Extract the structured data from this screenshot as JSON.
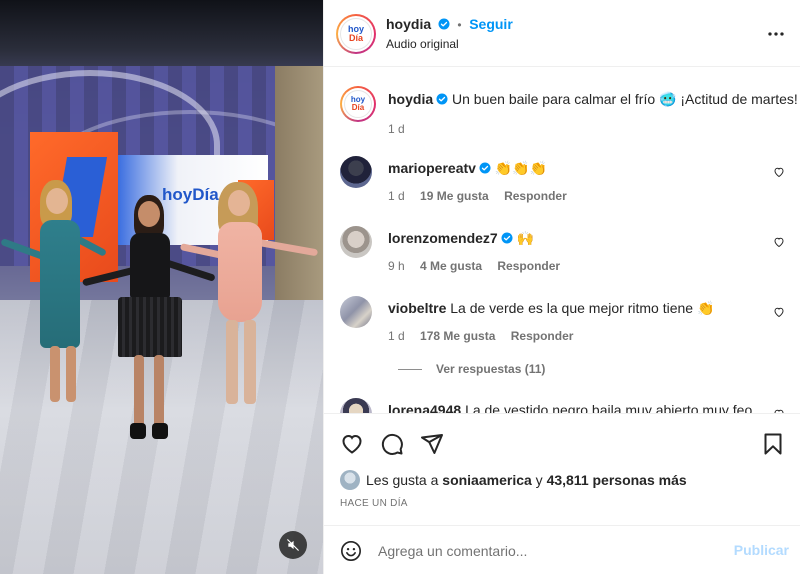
{
  "video": {
    "set_logo": "hoyDía",
    "mute_icon": "speaker-muted-icon"
  },
  "header": {
    "username": "hoydia",
    "dot": "•",
    "follow_label": "Seguir",
    "audio": "Audio original",
    "avatar_line1": "hoy",
    "avatar_line2": "Día",
    "more_icon": "more-horizontal-icon"
  },
  "caption": {
    "username": "hoydia",
    "text": "Un buen baile para calmar el frío 🥶 ¡Actitud de martes!",
    "time": "1 d"
  },
  "comments": [
    {
      "username": "mariopereatv",
      "verified": true,
      "text": "👏👏👏",
      "time": "1 d",
      "likes": "19 Me gusta",
      "reply": "Responder"
    },
    {
      "username": "lorenzomendez7",
      "verified": true,
      "text": "🙌",
      "time": "9 h",
      "likes": "4 Me gusta",
      "reply": "Responder"
    },
    {
      "username": "viobeltre",
      "verified": false,
      "text": "La de verde es la que mejor ritmo tiene 👏",
      "time": "1 d",
      "likes": "178 Me gusta",
      "reply": "Responder",
      "view_replies": "Ver respuestas (11)"
    },
    {
      "username": "lorena4948",
      "verified": false,
      "text": "La de vestido negro baila muy abierto muy feo"
    }
  ],
  "actions": {
    "likes_prefix": "Les gusta a",
    "likes_user": "soniaamerica",
    "likes_middle": "y",
    "likes_count": "43,811 personas más",
    "ago": "HACE UN DÍA"
  },
  "composer": {
    "placeholder": "Agrega un comentario...",
    "publish": "Publicar"
  },
  "colors": {
    "accent": "#0095f6",
    "publish_disabled": "#b3dbff",
    "text": "#262626",
    "muted": "#737373"
  }
}
